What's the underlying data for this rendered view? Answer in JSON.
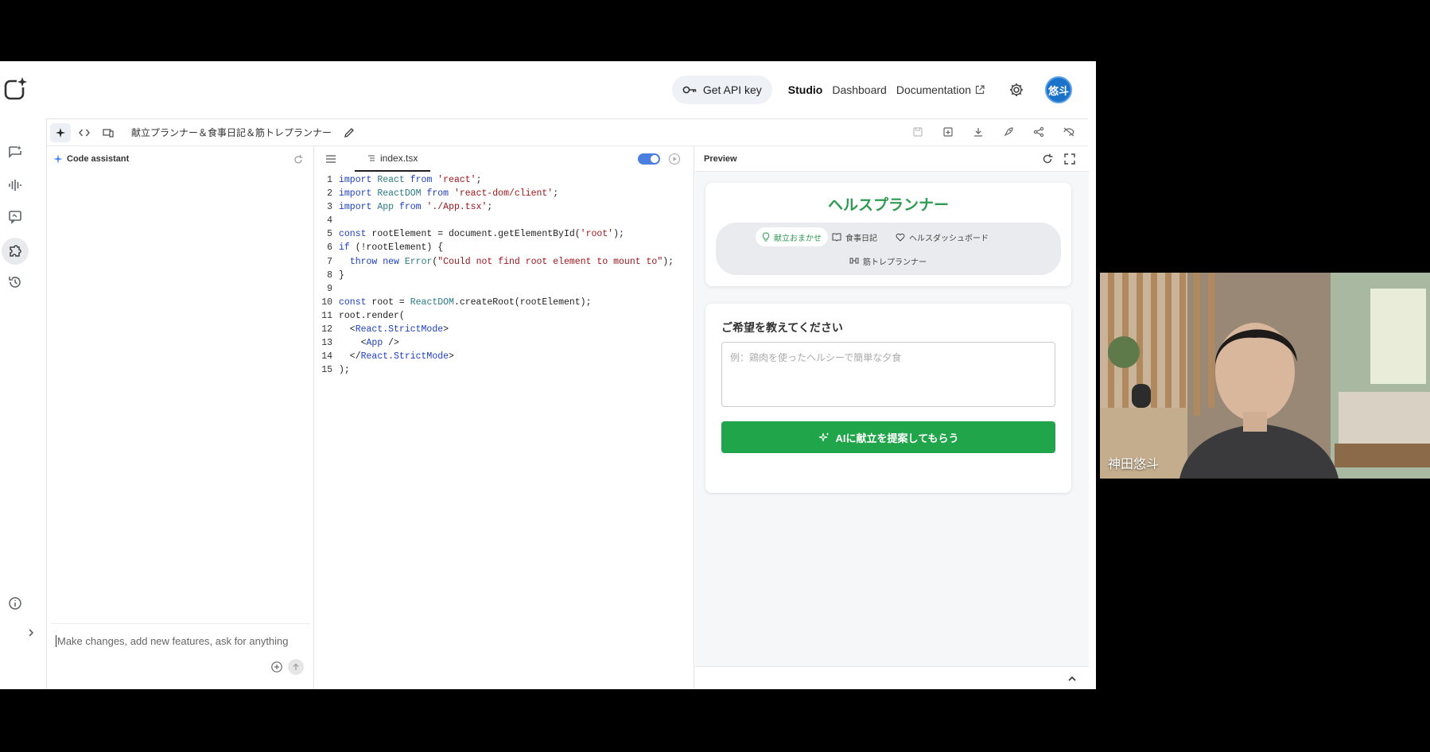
{
  "header": {
    "api_key_label": "Get API key",
    "nav": [
      "Studio",
      "Dashboard",
      "Documentation"
    ],
    "avatar_initials": "悠斗"
  },
  "toolbar": {
    "project_title": "献立プランナー＆食事日記＆筋トレプランナー"
  },
  "assistant": {
    "title": "Code assistant",
    "prompt_placeholder": "Make changes, add new features, ask for anything"
  },
  "editor": {
    "file_tab": "index.tsx",
    "toggle_on": true
  },
  "preview": {
    "title": "Preview",
    "app_title": "ヘルスプランナー",
    "nav": {
      "menu": "献立おまかせ",
      "diary": "食事日記",
      "dashboard": "ヘルスダッシュボード",
      "workout": "筋トレプランナー"
    },
    "question_label": "ご希望を教えてください",
    "question_placeholder": "例：鶏肉を使ったヘルシーで簡単な夕食",
    "submit_label": "AIに献立を提案してもらう",
    "accent_color": "#21a54a"
  },
  "webcam": {
    "participant_name": "神田悠斗"
  }
}
